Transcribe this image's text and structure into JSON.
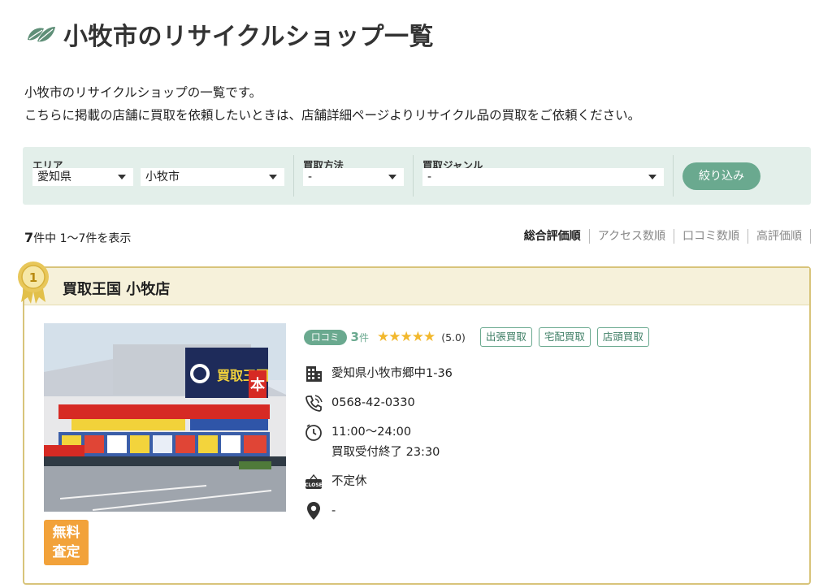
{
  "page": {
    "title": "小牧市のリサイクルショップ一覧",
    "intro_line1": "小牧市のリサイクルショップの一覧です。",
    "intro_line2": "こちらに掲載の店舗に買取を依頼したいときは、店舗詳細ページよりリサイクル品の買取をご依頼ください。"
  },
  "filters": {
    "area_label": "エリア",
    "prefecture": "愛知県",
    "city": "小牧市",
    "method_label": "買取方法",
    "method_value": "-",
    "genre_label": "買取ジャンル",
    "genre_value": "-",
    "submit_label": "絞り込み"
  },
  "results": {
    "total": "7",
    "summary_suffix": "件中 1〜7件を表示",
    "sort_options": [
      "総合評価順",
      "アクセス数順",
      "口コミ数順",
      "高評価順"
    ],
    "active_sort": "総合評価順"
  },
  "shop": {
    "rank": "1",
    "name": "買取王国 小牧店",
    "review_pill": "口コミ",
    "review_count": "3",
    "review_unit": "件",
    "rating": 5.0,
    "rating_text": "(5.0)",
    "tags": [
      "出張買取",
      "宅配買取",
      "店頭買取"
    ],
    "address": "愛知県小牧市郷中1-36",
    "phone": "0568-42-0330",
    "hours_line1": "11:00〜24:00",
    "hours_line2": "買取受付終了 23:30",
    "holiday": "不定休",
    "location": "-",
    "free_badge_line1": "無料",
    "free_badge_line2": "査定",
    "photo_sign": "買取王国",
    "photo_sign_big": "本",
    "close_sign_text": "CLOSE"
  },
  "colors": {
    "accent_green": "#6aa98f",
    "filter_bg": "#e3efea",
    "card_border": "#d8c47a",
    "card_header_bg": "#f6f1da",
    "star": "#f2b82d",
    "badge_orange": "#f2a23a"
  },
  "icons": {
    "title": "leaf-icon",
    "rank": "rank-medal-icon",
    "address": "building-icon",
    "phone": "phone-icon",
    "hours": "clock-icon",
    "holiday": "close-sign-icon",
    "location": "map-pin-icon"
  }
}
